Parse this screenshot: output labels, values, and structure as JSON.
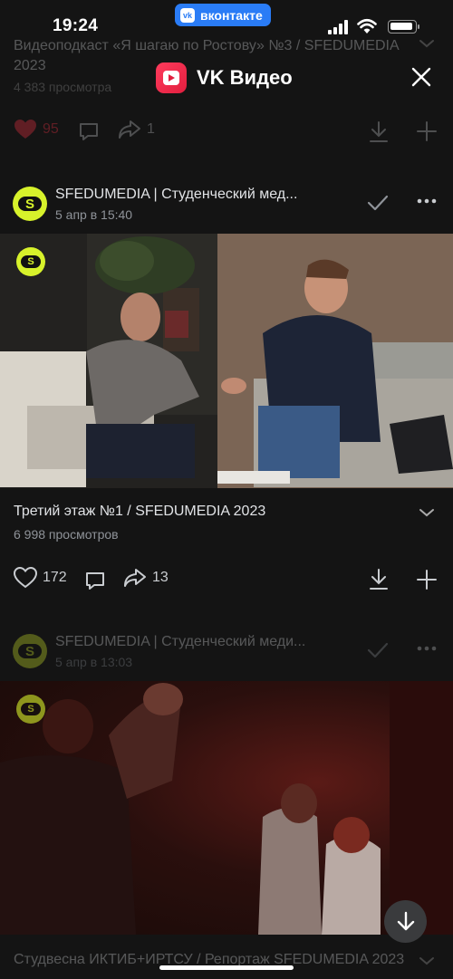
{
  "status": {
    "time": "19:24",
    "app_pill": "вконтакте",
    "vk_mark": "vk"
  },
  "header": {
    "title": "VK Видео"
  },
  "prev_post": {
    "title": "Видеоподкаст «Я шагаю по Ростову» №3 / SFEDUMEDIA 2023",
    "views": "4 383 просмотра",
    "likes": "95",
    "shares": "1"
  },
  "post1": {
    "channel": "SFEDUMEDIA | Студенческий мед...",
    "date": "5 апр в 15:40",
    "avatar_letter": "S",
    "title": "Третий этаж №1 / SFEDUMEDIA 2023",
    "views": "6 998 просмотров",
    "likes": "172",
    "shares": "13"
  },
  "post2": {
    "channel": "SFEDUMEDIA | Студенческий меди...",
    "date": "5 апр в 13:03",
    "avatar_letter": "S",
    "title": "Студвесна ИКТИБ+ИРТСУ / Репортаж SFEDUMEDIA 2023"
  },
  "colors": {
    "accent": "#2a7cf6",
    "brand_yellow": "#d7f22b",
    "like_red": "#ff3347",
    "bg": "#141414"
  },
  "icons": [
    "heart-icon",
    "comment-icon",
    "share-icon",
    "download-icon",
    "plus-icon",
    "check-icon",
    "more-icon",
    "chevron-down-icon",
    "close-icon",
    "arrow-down-icon"
  ]
}
